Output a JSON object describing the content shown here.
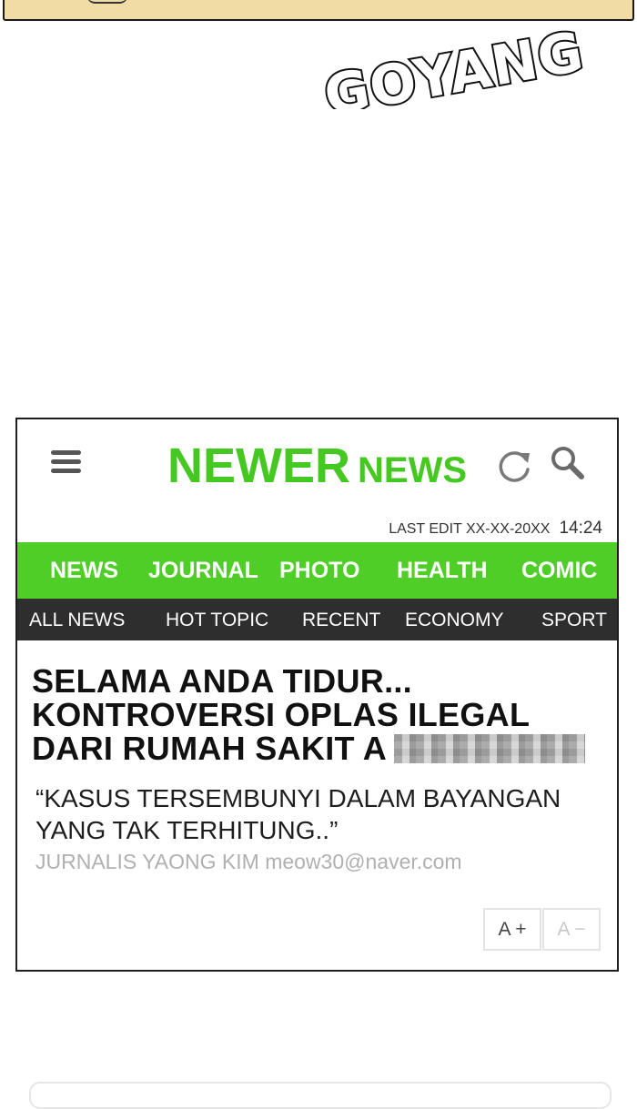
{
  "comic": {
    "sound_effect": "GOYANG"
  },
  "app": {
    "logo_main": "NEWER",
    "logo_sub": "NEWS",
    "last_edit_label": "LAST EDIT XX-XX-20XX",
    "time": "14:24",
    "brand_color": "#4fce28"
  },
  "nav_primary": {
    "items": [
      "NEWS",
      "JOURNAL",
      "PHOTO",
      "HEALTH",
      "COMIC"
    ]
  },
  "nav_secondary": {
    "items": [
      "ALL NEWS",
      "HOT TOPIC",
      "RECENT",
      "ECONOMY",
      "SPORT"
    ]
  },
  "article": {
    "headline_lines": [
      "SELAMA ANDA TIDUR...",
      "KONTROVERSI OPLAS ILEGAL",
      "DARI RUMAH SAKIT A"
    ],
    "quote_lines": [
      "“KASUS TERSEMBUNYI DALAM BAYANGAN",
      "YANG TAK TERHITUNG..”"
    ],
    "byline": "JURNALIS YAONG KIM meow30@naver.com"
  },
  "font_controls": {
    "increase_label": "A +",
    "decrease_label": "A −"
  },
  "icons": [
    "menu-icon",
    "refresh-icon",
    "search-icon"
  ]
}
